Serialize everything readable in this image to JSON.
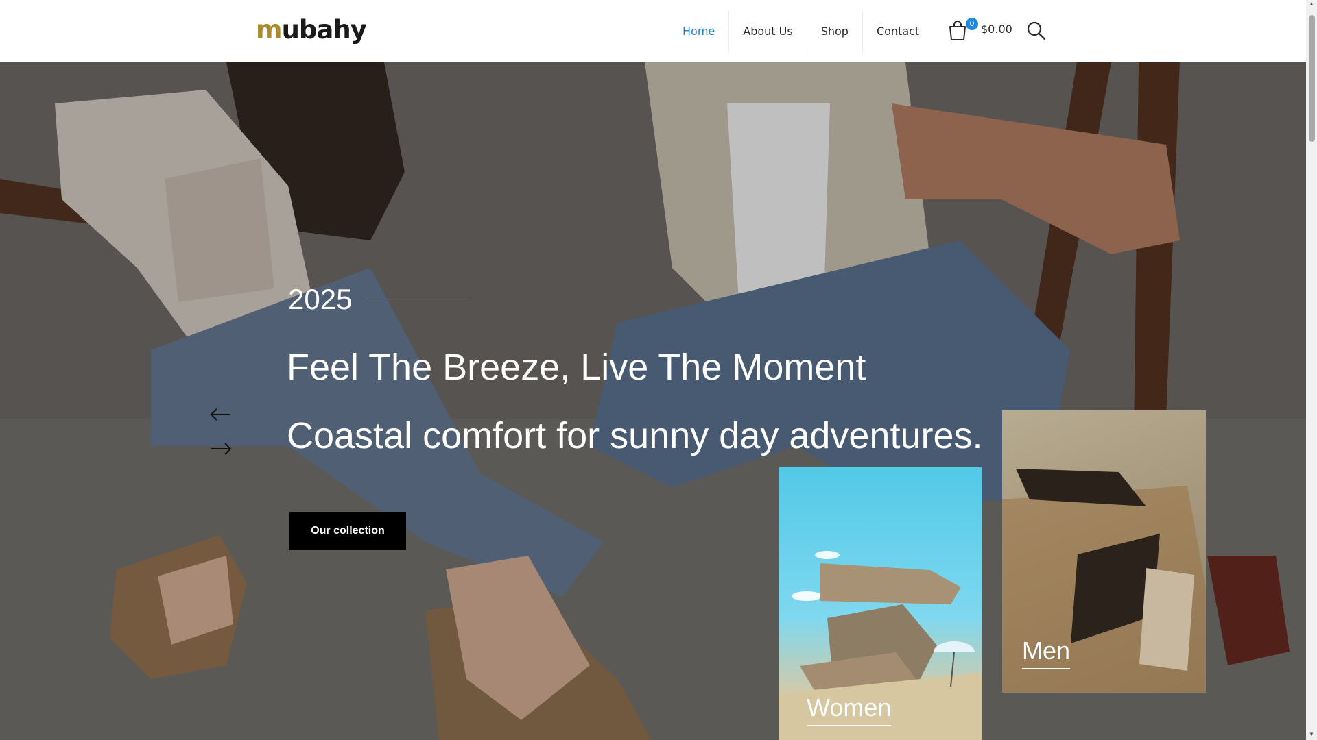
{
  "brand": {
    "logo_first": "m",
    "logo_rest": "ubahy",
    "accent": "#a98a2c"
  },
  "nav": {
    "items": [
      "Home",
      "About Us",
      "Shop",
      "Contact"
    ],
    "active": "Home",
    "active_color": "#1d7fc4"
  },
  "cart": {
    "count": "0",
    "total": "$0.00",
    "icon": "shopping-bag-icon"
  },
  "search": {
    "icon": "search-icon"
  },
  "hero": {
    "year": "2025",
    "heading": "Feel The Breeze, Live The Moment",
    "subheading": "Coastal comfort for sunny day adventures.",
    "button_label": "Our collection",
    "prev_icon": "arrow-left-icon",
    "next_icon": "arrow-right-icon"
  },
  "categories": [
    {
      "label": "Women"
    },
    {
      "label": "Men"
    }
  ]
}
